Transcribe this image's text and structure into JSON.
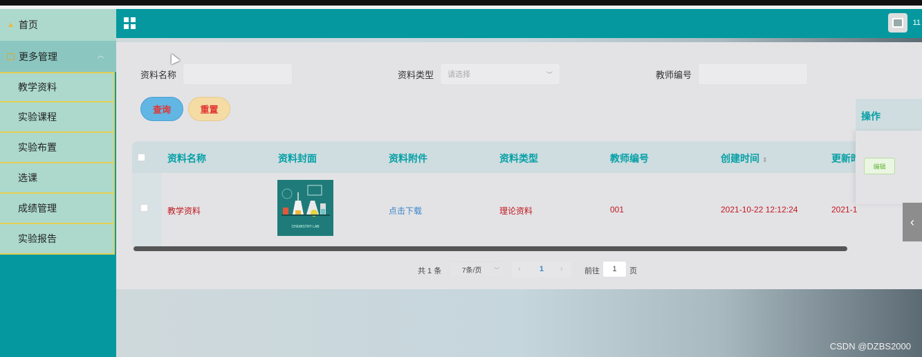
{
  "sidebar": {
    "home_label": "首页",
    "more_label": "更多管理",
    "items": [
      {
        "label": "教学资料"
      },
      {
        "label": "实验课程"
      },
      {
        "label": "实验布置"
      },
      {
        "label": "选课"
      },
      {
        "label": "成绩管理"
      },
      {
        "label": "实验报告"
      }
    ]
  },
  "header": {
    "user_name": "11"
  },
  "search": {
    "name_label": "资料名称",
    "name_value": "",
    "type_label": "资料类型",
    "type_placeholder": "请选择",
    "teacher_label": "教师编号",
    "teacher_value": "",
    "query_label": "查询",
    "reset_label": "重置"
  },
  "table": {
    "columns": [
      "资料名称",
      "资料封面",
      "资料附件",
      "资料类型",
      "教师编号",
      "创建时间",
      "更新时",
      "操作"
    ],
    "rows": [
      {
        "name": "教学资料",
        "cover_text": "CHEMISTRY LAB",
        "attachment": "点击下载",
        "type": "理论资料",
        "teacher_no": "001",
        "created": "2021-10-22 12:12:24",
        "updated": "2021-1",
        "action": "编辑"
      }
    ]
  },
  "pagination": {
    "total": "共 1 条",
    "page_size": "7条/页",
    "current_page": "1",
    "goto_label": "前往",
    "goto_value": "1",
    "goto_unit": "页"
  },
  "watermark": "CSDN @DZBS2000",
  "colors": {
    "teal": "#05999f",
    "sidebar_item": "#acd9cc",
    "highlight_border": "#e6ce52",
    "table_header_text": "#06a0a6",
    "cell_text": "#c1171d",
    "link": "#3a84c8"
  }
}
